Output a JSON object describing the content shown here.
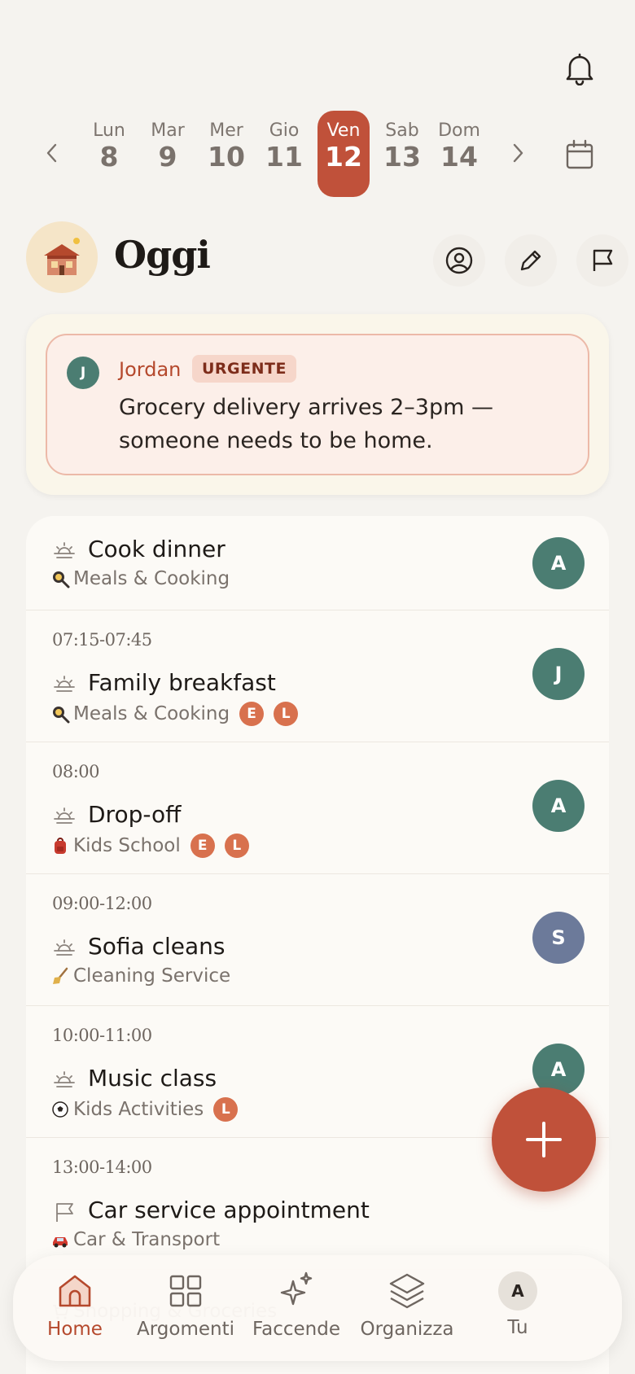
{
  "week": {
    "days": [
      {
        "name": "Lun",
        "num": "8"
      },
      {
        "name": "Mar",
        "num": "9"
      },
      {
        "name": "Mer",
        "num": "10"
      },
      {
        "name": "Gio",
        "num": "11"
      },
      {
        "name": "Ven",
        "num": "12"
      },
      {
        "name": "Sab",
        "num": "13"
      },
      {
        "name": "Dom",
        "num": "14"
      }
    ],
    "selected_index": 4
  },
  "header": {
    "title": "Oggi"
  },
  "urgent": {
    "initial": "J",
    "author": "Jordan",
    "badge": "URGENTE",
    "message": "Grocery delivery arrives 2–3pm — someone needs to be home."
  },
  "tasks": [
    {
      "time": "",
      "name": "Cook dinner",
      "icon": "sunrise-icon",
      "category": "Meals & Cooking",
      "category_icon": "pan-icon",
      "members": [],
      "assignee": "A",
      "assignee_color": "#4b7d72"
    },
    {
      "time": "07:15-07:45",
      "name": "Family breakfast",
      "icon": "sunrise-icon",
      "category": "Meals & Cooking",
      "category_icon": "pan-icon",
      "members": [
        "E",
        "L"
      ],
      "assignee": "J",
      "assignee_color": "#4b7d72"
    },
    {
      "time": "08:00",
      "name": "Drop-off",
      "icon": "sunrise-icon",
      "category": "Kids School",
      "category_icon": "backpack-icon",
      "members": [
        "E",
        "L"
      ],
      "assignee": "A",
      "assignee_color": "#4b7d72"
    },
    {
      "time": "09:00-12:00",
      "name": "Sofia cleans",
      "icon": "sunrise-icon",
      "category": "Cleaning Service",
      "category_icon": "broom-icon",
      "members": [],
      "assignee": "S",
      "assignee_color": "#6c7a9a"
    },
    {
      "time": "10:00-11:00",
      "name": "Music class",
      "icon": "sunrise-icon",
      "category": "Kids Activities",
      "category_icon": "soccer-ball-icon",
      "members": [
        "L"
      ],
      "assignee": "A",
      "assignee_color": "#4b7d72"
    },
    {
      "time": "13:00-14:00",
      "name": "Car service appointment",
      "icon": "flag-icon",
      "category": "Car & Transport",
      "category_icon": "car-icon",
      "members": [],
      "assignee": "",
      "assignee_color": "#4b7d72"
    },
    {
      "time": "",
      "name": "",
      "icon": "",
      "category": "Shopping & Groceries",
      "category_icon": "cart-icon",
      "members": [],
      "assignee": "",
      "assignee_color": "#4b7d72"
    }
  ],
  "nav": {
    "items": [
      {
        "label": "Home",
        "icon": "home-icon",
        "active": true
      },
      {
        "label": "Argomenti",
        "icon": "grid-icon",
        "active": false
      },
      {
        "label": "Faccende",
        "icon": "sparkle-icon",
        "active": false
      },
      {
        "label": "Organizza",
        "icon": "layers-icon",
        "active": false
      },
      {
        "label": "Tu",
        "icon": "avatar",
        "active": false,
        "initial": "A"
      }
    ]
  },
  "colors": {
    "accent": "#c0513a",
    "background": "#f5f3ef",
    "card": "#fcfaf6",
    "avatar_green": "#4b7d72",
    "avatar_blue": "#6c7a9a",
    "member_orange": "#d8714e"
  }
}
